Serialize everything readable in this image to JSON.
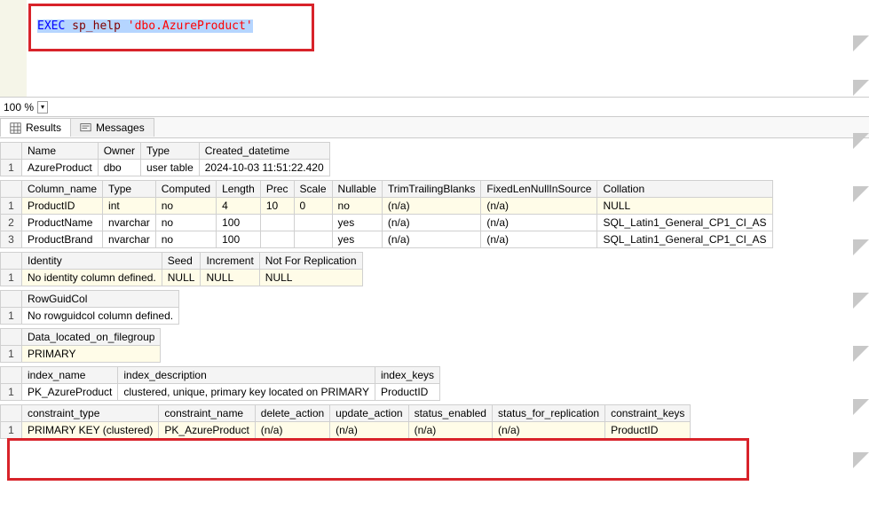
{
  "query": {
    "keyword": "EXEC",
    "procedure": "sp_help",
    "argument": "'dbo.AzureProduct'"
  },
  "zoom": {
    "value": "100 %"
  },
  "tabs": {
    "results": "Results",
    "messages": "Messages"
  },
  "table1": {
    "headers": [
      "Name",
      "Owner",
      "Type",
      "Created_datetime"
    ],
    "rows": [
      {
        "n": "1",
        "cells": [
          "AzureProduct",
          "dbo",
          "user table",
          "2024-10-03 11:51:22.420"
        ]
      }
    ]
  },
  "table2": {
    "headers": [
      "Column_name",
      "Type",
      "Computed",
      "Length",
      "Prec",
      "Scale",
      "Nullable",
      "TrimTrailingBlanks",
      "FixedLenNullInSource",
      "Collation"
    ],
    "rows": [
      {
        "n": "1",
        "hl": true,
        "cells": [
          "ProductID",
          "int",
          "no",
          "4",
          "10",
          "0",
          "no",
          "(n/a)",
          "(n/a)",
          "NULL"
        ]
      },
      {
        "n": "2",
        "hl": false,
        "cells": [
          "ProductName",
          "nvarchar",
          "no",
          "100",
          "",
          "",
          "yes",
          "(n/a)",
          "(n/a)",
          "SQL_Latin1_General_CP1_CI_AS"
        ]
      },
      {
        "n": "3",
        "hl": false,
        "cells": [
          "ProductBrand",
          "nvarchar",
          "no",
          "100",
          "",
          "",
          "yes",
          "(n/a)",
          "(n/a)",
          "SQL_Latin1_General_CP1_CI_AS"
        ]
      }
    ]
  },
  "table3": {
    "headers": [
      "Identity",
      "Seed",
      "Increment",
      "Not For Replication"
    ],
    "rows": [
      {
        "n": "1",
        "hl": true,
        "cells": [
          "No identity column defined.",
          "NULL",
          "NULL",
          "NULL"
        ]
      }
    ]
  },
  "table4": {
    "headers": [
      "RowGuidCol"
    ],
    "rows": [
      {
        "n": "1",
        "cells": [
          "No rowguidcol column defined."
        ]
      }
    ]
  },
  "table5": {
    "headers": [
      "Data_located_on_filegroup"
    ],
    "rows": [
      {
        "n": "1",
        "hl": true,
        "cells": [
          "PRIMARY"
        ]
      }
    ]
  },
  "table6": {
    "headers": [
      "index_name",
      "index_description",
      "index_keys"
    ],
    "rows": [
      {
        "n": "1",
        "cells": [
          "PK_AzureProduct",
          "clustered, unique, primary key located on PRIMARY",
          "ProductID"
        ]
      }
    ]
  },
  "table7": {
    "headers": [
      "constraint_type",
      "constraint_name",
      "delete_action",
      "update_action",
      "status_enabled",
      "status_for_replication",
      "constraint_keys"
    ],
    "rows": [
      {
        "n": "1",
        "hl": true,
        "cells": [
          "PRIMARY KEY (clustered)",
          "PK_AzureProduct",
          "(n/a)",
          "(n/a)",
          "(n/a)",
          "(n/a)",
          "ProductID"
        ]
      }
    ]
  }
}
